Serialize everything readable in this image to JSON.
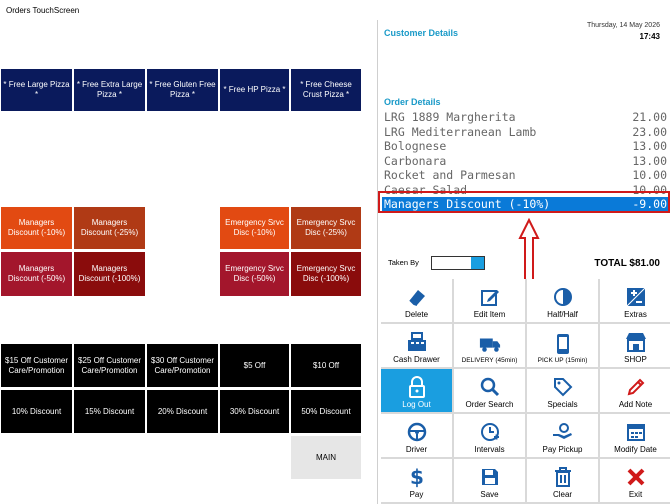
{
  "window": {
    "title": "Orders TouchScreen"
  },
  "promo_row": [
    "* Free Large Pizza *",
    "* Free Extra Large Pizza *",
    "* Free Gluten Free Pizza *",
    "* Free HP Pizza *",
    "* Free Cheese Crust Pizza *"
  ],
  "discounts_left": [
    "Managers Discount (-10%)",
    "Managers Discount (-25%)",
    "Managers Discount (-50%)",
    "Managers Discount (-100%)"
  ],
  "discounts_right": [
    "Emergency Srvc Disc (-10%)",
    "Emergency Srvc Disc (-25%)",
    "Emergency Srvc Disc (-50%)",
    "Emergency Srvc Disc (-100%)"
  ],
  "off_row": [
    "$15 Off Customer Care/Promotion",
    "$25 Off Customer Care/Promotion",
    "$30 Off Customer Care/Promotion",
    "$5 Off",
    "$10 Off"
  ],
  "pct_row": [
    "10% Discount",
    "15% Discount",
    "20% Discount",
    "30% Discount",
    "50% Discount"
  ],
  "main_button": "MAIN",
  "header": {
    "date": "Thursday, 14 May 2026",
    "time": "17:43"
  },
  "customer_details_title": "Customer Details",
  "order_details_title": "Order Details",
  "orders": [
    {
      "name": "LRG 1889 Margherita",
      "price": "21.00"
    },
    {
      "name": "LRG Mediterranean Lamb",
      "price": "23.00"
    },
    {
      "name": "Bolognese",
      "price": "13.00"
    },
    {
      "name": "Carbonara",
      "price": "13.00"
    },
    {
      "name": "Rocket and Parmesan",
      "price": "10.00"
    },
    {
      "name": "Caesar Salad",
      "price": "10.00"
    },
    {
      "name": "Managers Discount (-10%)",
      "price": "-9.00"
    }
  ],
  "taken_by_label": "Taken By",
  "total": "TOTAL  $81.00",
  "actions": [
    {
      "label": "Delete",
      "icon": "eraser-icon"
    },
    {
      "label": "Edit Item",
      "icon": "edit-icon"
    },
    {
      "label": "Half/Half",
      "icon": "half-circle-icon"
    },
    {
      "label": "Extras",
      "icon": "plus-minus-icon"
    },
    {
      "label": "Cash Drawer",
      "icon": "cash-register-icon"
    },
    {
      "label": "DELIVERY (45min)",
      "icon": "truck-icon"
    },
    {
      "label": "PICK UP (15min)",
      "icon": "phone-icon"
    },
    {
      "label": "SHOP",
      "icon": "shop-icon"
    },
    {
      "label": "Log Out",
      "icon": "lock-icon"
    },
    {
      "label": "Order Search",
      "icon": "search-icon"
    },
    {
      "label": "Specials",
      "icon": "tag-icon"
    },
    {
      "label": "Add Note",
      "icon": "pencil-icon"
    },
    {
      "label": "Driver",
      "icon": "steering-wheel-icon"
    },
    {
      "label": "Intervals",
      "icon": "clock-plus-icon"
    },
    {
      "label": "Pay Pickup",
      "icon": "hand-coin-icon"
    },
    {
      "label": "Modify Date",
      "icon": "calendar-icon"
    },
    {
      "label": "Pay",
      "icon": "dollar-icon"
    },
    {
      "label": "Save",
      "icon": "save-icon"
    },
    {
      "label": "Clear",
      "icon": "trash-icon"
    },
    {
      "label": "Exit",
      "icon": "close-icon"
    }
  ],
  "colors": {
    "accent": "#1a9ee0",
    "selection_box": "#d01a1a",
    "navy": "#0a1a5c",
    "icon": "#1a5ea8"
  }
}
